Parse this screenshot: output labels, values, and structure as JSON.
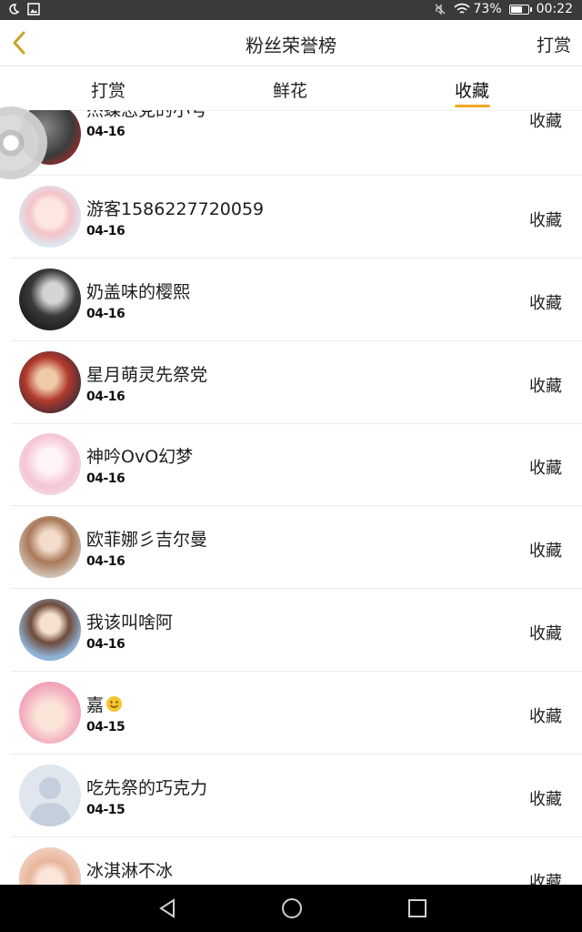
{
  "status_bar": {
    "battery": "73%",
    "time": "00:22",
    "battery_level": 0.73
  },
  "header": {
    "title": "粉丝荣誉榜",
    "right_action": "打赏"
  },
  "tabs": [
    {
      "label": "打赏"
    },
    {
      "label": "鲜花"
    },
    {
      "label": "收藏",
      "active": true
    }
  ],
  "fans": [
    {
      "name": "杰蝶恋党的小号",
      "date": "04-16",
      "action": "收藏"
    },
    {
      "name": "游客1586227720059",
      "date": "04-16",
      "action": "收藏"
    },
    {
      "name": "奶盖味的樱熙",
      "date": "04-16",
      "action": "收藏"
    },
    {
      "name": "星月萌灵先祭党",
      "date": "04-16",
      "action": "收藏"
    },
    {
      "name": "神吟OvO幻梦",
      "date": "04-16",
      "action": "收藏"
    },
    {
      "name": "欧菲娜彡吉尔曼",
      "date": "04-16",
      "action": "收藏"
    },
    {
      "name": "我该叫啥阿",
      "date": "04-16",
      "action": "收藏"
    },
    {
      "name": "嘉",
      "date": "04-15",
      "action": "收藏",
      "emoji": "smiley"
    },
    {
      "name": "吃先祭的巧克力",
      "date": "04-15",
      "action": "收藏"
    },
    {
      "name": "冰淇淋不冰",
      "date": "",
      "action": "收藏"
    }
  ],
  "colors": {
    "accent": "#f5a623",
    "back_arrow": "#c9a227"
  }
}
